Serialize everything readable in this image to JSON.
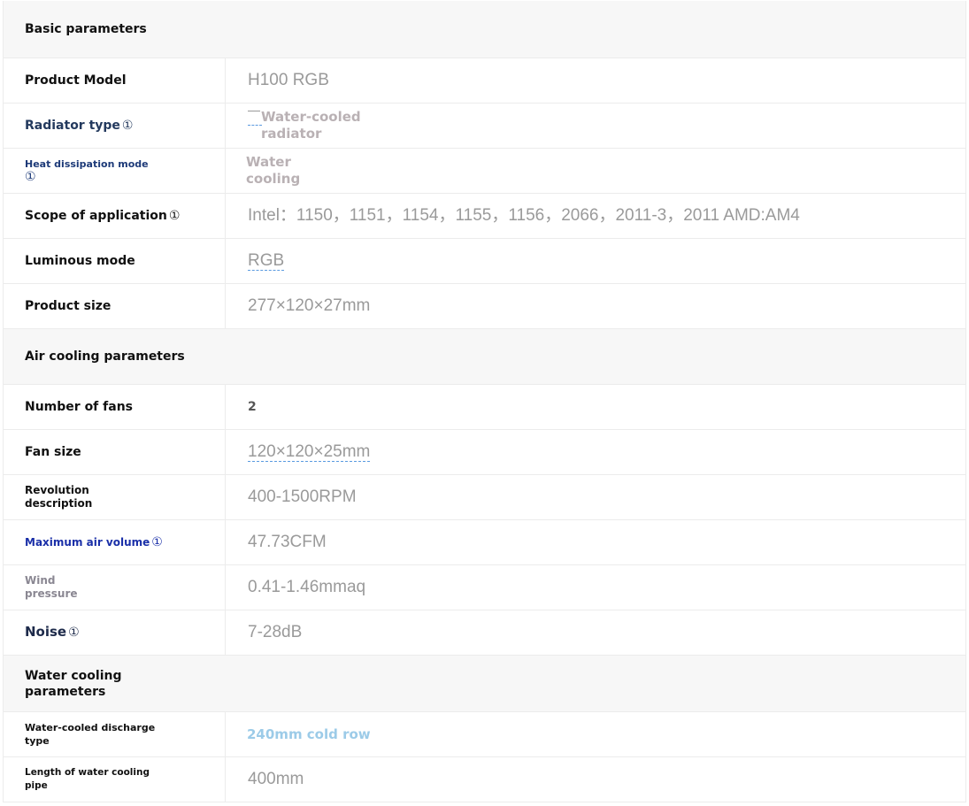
{
  "info_glyph": "①",
  "colors": {
    "section_bg": "#f7f7f7",
    "value_gray": "#9a9a9a",
    "link_blue": "#1a2fa8",
    "light_blue": "#9ccbe8"
  },
  "sections": {
    "basic": {
      "title": "Basic parameters",
      "rows": {
        "model": {
          "label": "Product Model",
          "value": "H100 RGB"
        },
        "radiator": {
          "label": "Radiator type",
          "value_line1": "Water-cooled",
          "value_line2": "radiator"
        },
        "heat": {
          "label_line1": "Heat dissipation mode",
          "value_line1": "Water",
          "value_line2": "cooling"
        },
        "scope": {
          "label": "Scope of application",
          "value": "Intel：1150，1151，1154，1155，1156，2066，2011-3，2011 AMD:AM4"
        },
        "luminous": {
          "label": "Luminous mode",
          "value": "RGB"
        },
        "size": {
          "label": "Product size",
          "value": "277×120×27mm"
        }
      }
    },
    "air": {
      "title": "Air cooling parameters",
      "rows": {
        "fans": {
          "label": "Number of fans",
          "value": "2"
        },
        "fansize": {
          "label": "Fan size",
          "value": "120×120×25mm"
        },
        "rev": {
          "label_line1": "Revolution",
          "label_line2": "description",
          "value": "400-1500RPM"
        },
        "airvol": {
          "label": "Maximum air volume",
          "value": "47.73CFM"
        },
        "wind": {
          "label_line1": "Wind",
          "label_line2": "pressure",
          "value": "0.41-1.46mmaq"
        },
        "noise": {
          "label": "Noise",
          "value": "7-28dB"
        }
      }
    },
    "water": {
      "title_line1": "Water cooling",
      "title_line2": "parameters",
      "rows": {
        "discharge": {
          "label_line1": "Water-cooled discharge",
          "label_line2": "type",
          "value": "240mm cold row"
        },
        "pipe": {
          "label_line1": "Length of water cooling",
          "label_line2": "pipe",
          "value": "400mm"
        }
      }
    }
  }
}
